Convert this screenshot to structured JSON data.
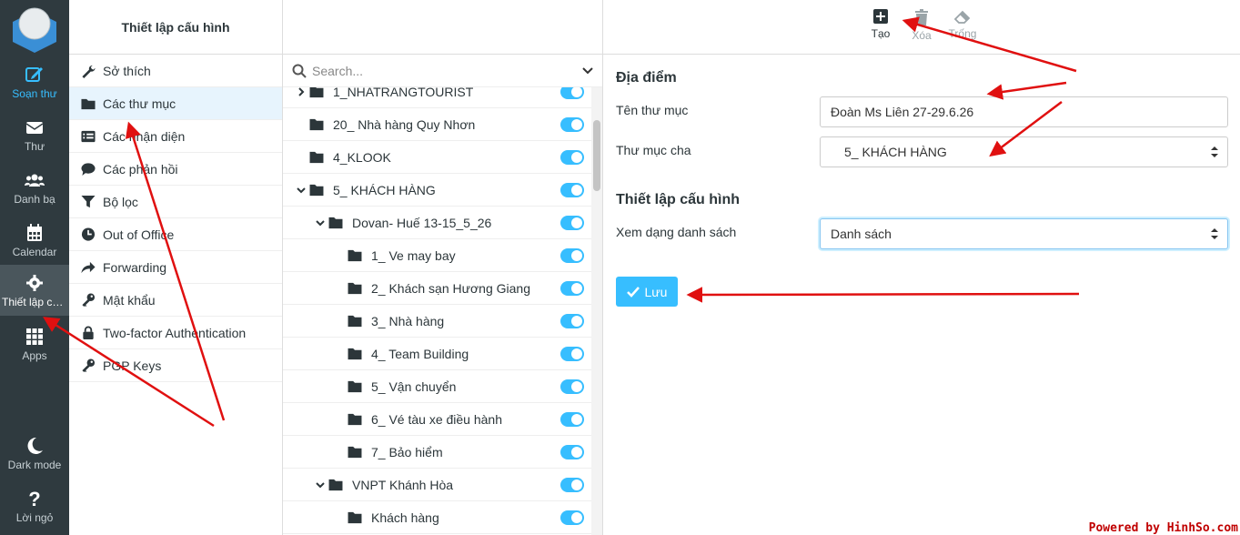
{
  "rail": {
    "compose": "Soạn thư",
    "mail": "Thư",
    "contacts": "Danh bạ",
    "calendar": "Calendar",
    "settings": "Thiết lập cấu hình",
    "apps": "Apps",
    "dark_mode": "Dark mode",
    "help": "Lời ngỏ"
  },
  "settings_menu": {
    "header": "Thiết lập cấu hình",
    "items": [
      {
        "label": "Sở thích",
        "icon": "wrench-icon"
      },
      {
        "label": "Các thư mục",
        "icon": "folder-icon",
        "selected": true
      },
      {
        "label": "Các nhận diện",
        "icon": "id-card-icon"
      },
      {
        "label": "Các phản hồi",
        "icon": "comment-icon"
      },
      {
        "label": "Bộ lọc",
        "icon": "filter-icon"
      },
      {
        "label": "Out of Office",
        "icon": "clock-icon"
      },
      {
        "label": "Forwarding",
        "icon": "share-icon"
      },
      {
        "label": "Mật khẩu",
        "icon": "key-icon"
      },
      {
        "label": "Two-factor Authentication",
        "icon": "lock-icon"
      },
      {
        "label": "PGP Keys",
        "icon": "key-icon"
      }
    ]
  },
  "folders": {
    "search_placeholder": "Search...",
    "items": [
      {
        "name": "1_NHATRANGTOURIST",
        "level": 0,
        "expander": "collapsed",
        "subscribed": true
      },
      {
        "name": "20_ Nhà hàng Quy Nhơn",
        "level": 0,
        "expander": "none",
        "subscribed": true
      },
      {
        "name": "4_KLOOK",
        "level": 0,
        "expander": "none",
        "subscribed": true
      },
      {
        "name": "5_ KHÁCH HÀNG",
        "level": 0,
        "expander": "expanded",
        "subscribed": true
      },
      {
        "name": "Dovan- Huế 13-15_5_26",
        "level": 1,
        "expander": "expanded",
        "subscribed": true
      },
      {
        "name": "1_ Ve may bay",
        "level": 2,
        "expander": "none",
        "subscribed": true
      },
      {
        "name": "2_ Khách sạn Hương Giang",
        "level": 2,
        "expander": "none",
        "subscribed": true
      },
      {
        "name": "3_ Nhà hàng",
        "level": 2,
        "expander": "none",
        "subscribed": true
      },
      {
        "name": "4_ Team Building",
        "level": 2,
        "expander": "none",
        "subscribed": true
      },
      {
        "name": "5_ Vận chuyển",
        "level": 2,
        "expander": "none",
        "subscribed": true
      },
      {
        "name": "6_ Vé tàu xe điều hành",
        "level": 2,
        "expander": "none",
        "subscribed": true
      },
      {
        "name": "7_ Bảo hiểm",
        "level": 2,
        "expander": "none",
        "subscribed": true
      },
      {
        "name": "VNPT Khánh Hòa",
        "level": 1,
        "expander": "expanded",
        "subscribed": true
      },
      {
        "name": "Khách hàng",
        "level": 2,
        "expander": "none",
        "subscribed": true
      }
    ]
  },
  "toolbar": {
    "create": "Tạo",
    "delete": "Xóa",
    "empty": "Trống"
  },
  "form": {
    "location_title": "Địa điểm",
    "folder_name_label": "Tên thư mục",
    "folder_name_value": "Đoàn Ms Liên 27-29.6.26",
    "parent_label": "Thư mục cha",
    "parent_value": "5_ KHÁCH HÀNG",
    "config_title": "Thiết lập cấu hình",
    "view_label": "Xem dạng danh sách",
    "view_value": "Danh sách",
    "save": "Lưu"
  },
  "colors": {
    "accent": "#37beff",
    "rail_bg": "#2f3a3f",
    "annotation_arrow": "#e01010"
  },
  "watermark": "Powered by HinhSo.com"
}
